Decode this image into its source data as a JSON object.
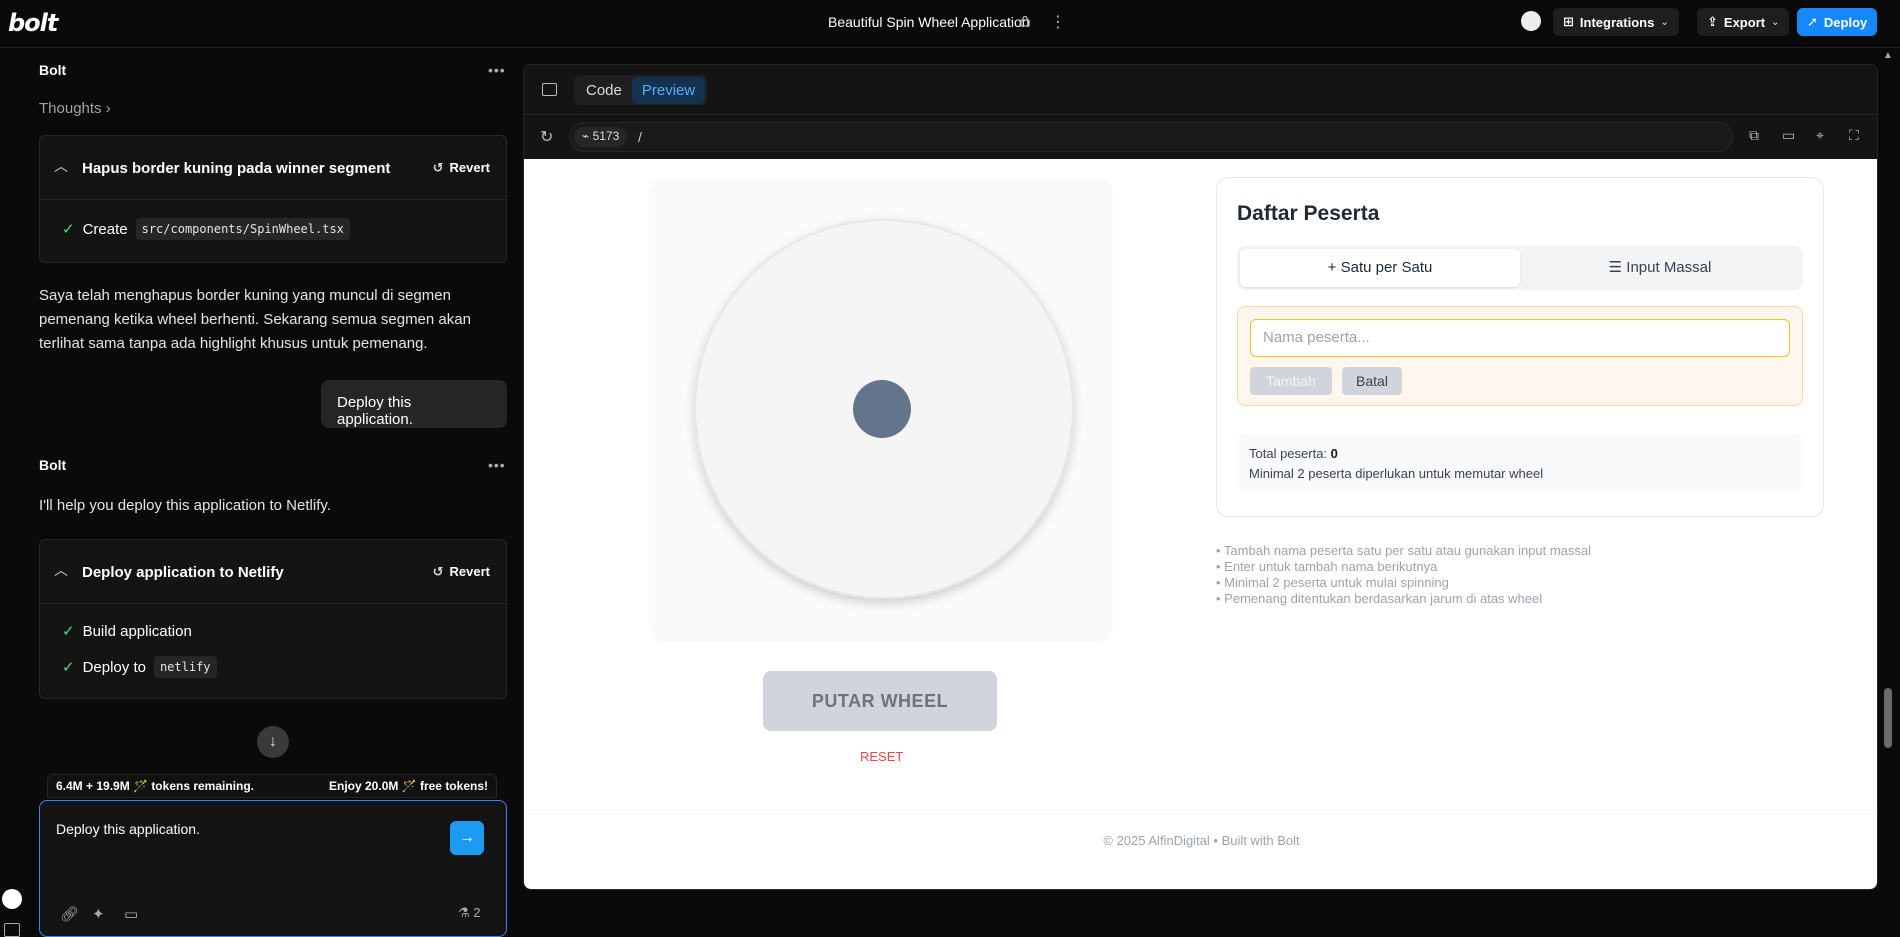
{
  "topbar": {
    "logo": "bolt",
    "project_title": "Beautiful Spin Wheel Application",
    "more": "⋮",
    "integrations_label": "Integrations",
    "export_label": "Export",
    "deploy_label": "Deploy"
  },
  "chat": {
    "bolt_label_1": "Bolt",
    "bolt_label_2": "Bolt",
    "more": "•••",
    "thoughts": "Thoughts ›",
    "card1": {
      "title": "Hapus border kuning pada winner segment",
      "revert": "Revert",
      "step_label": "Create",
      "step_code": "src/components/SpinWheel.tsx"
    },
    "message1": "Saya telah menghapus border kuning yang muncul di segmen pemenang ketika wheel berhenti. Sekarang semua segmen akan terlihat sama tanpa ada highlight khusus untuk pemenang.",
    "user_message": "Deploy this application.",
    "message2": "I'll help you deploy this application to Netlify.",
    "card2": {
      "title": "Deploy application to Netlify",
      "revert": "Revert",
      "step1": "Build application",
      "step2_label": "Deploy to",
      "step2_code": "netlify"
    },
    "tokens_left": "6.4M + 19.9M 🪄 tokens remaining.",
    "tokens_right": "Enjoy 20.0M 🪄 free tokens!",
    "input_value": "Deploy this application.",
    "count": "2"
  },
  "preview": {
    "tab_code": "Code",
    "tab_preview": "Preview",
    "port": "5173",
    "path": "/"
  },
  "app": {
    "spin_button": "PUTAR WHEEL",
    "reset_button": "RESET",
    "peserta_title": "Daftar Peserta",
    "tab_single": "+ Satu per Satu",
    "tab_bulk": "☰ Input Massal",
    "name_placeholder": "Nama peserta...",
    "tambah": "Tambah",
    "batal": "Batal",
    "total_label": "Total peserta:",
    "total_value": "0",
    "min_info": "Minimal 2 peserta diperlukan untuk memutar wheel",
    "tips": [
      "• Tambah nama peserta satu per satu atau gunakan input massal",
      "• Enter untuk tambah nama berikutnya",
      "• Minimal 2 peserta untuk mulai spinning",
      "• Pemenang ditentukan berdasarkan jarum di atas wheel"
    ],
    "footer": "© 2025 AlfinDigital • Built with Bolt"
  }
}
